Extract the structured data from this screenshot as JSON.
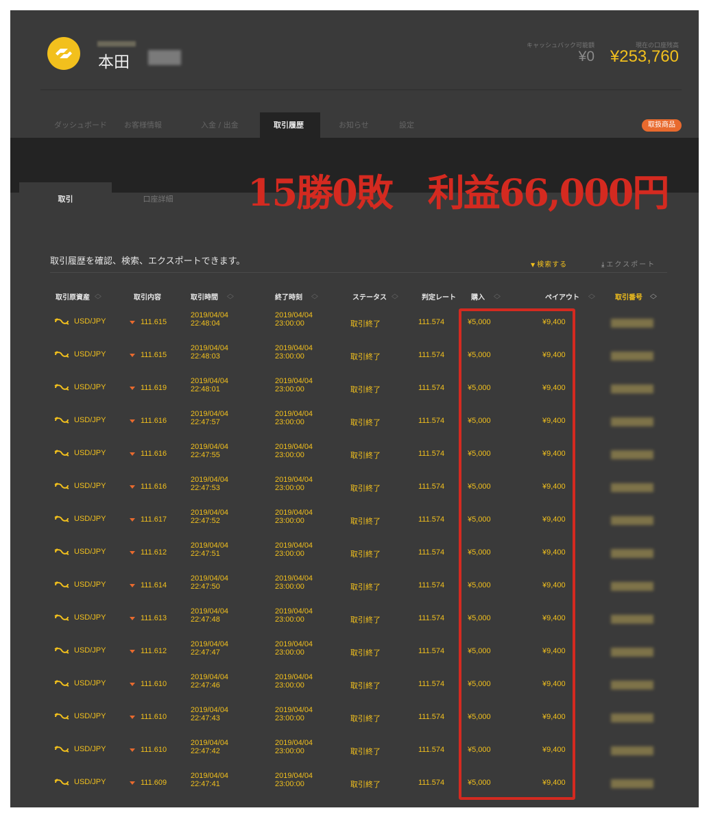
{
  "header": {
    "user_name": "本田",
    "cashback_label": "キャッシュバック可能額",
    "cashback_value": "¥0",
    "balance_label": "現在の口座残高",
    "balance_value": "¥253,760",
    "logo_icon": "swap-logo-icon"
  },
  "nav": {
    "items": [
      "ダッシュボード",
      "お客様情報",
      "入金 / 出金",
      "取引履歴",
      "お知らせ",
      "設定"
    ],
    "active": "取引履歴",
    "products_button": "取扱商品"
  },
  "subtabs": [
    "取引",
    "口座詳細"
  ],
  "overlay_text": "15勝0敗　利益66,000円",
  "toolbar": {
    "intro": "取引履歴を確認、検索、エクスポートできます。",
    "search": "検索する",
    "export": "エクスポート"
  },
  "table": {
    "headers": [
      "取引原資産",
      "取引内容",
      "取引時間",
      "終了時刻",
      "ステータス",
      "判定レート",
      "購入",
      "ペイアウト",
      "取引番号"
    ],
    "rows": [
      {
        "asset": "USD/JPY",
        "content": "111.615",
        "date": "2019/04/04",
        "time": "22:48:04",
        "end_date": "2019/04/04",
        "end_time": "23:00:00",
        "status": "取引終了",
        "rate": "111.574",
        "buy": "¥5,000",
        "payout": "¥9,400"
      },
      {
        "asset": "USD/JPY",
        "content": "111.615",
        "date": "2019/04/04",
        "time": "22:48:03",
        "end_date": "2019/04/04",
        "end_time": "23:00:00",
        "status": "取引終了",
        "rate": "111.574",
        "buy": "¥5,000",
        "payout": "¥9,400"
      },
      {
        "asset": "USD/JPY",
        "content": "111.619",
        "date": "2019/04/04",
        "time": "22:48:01",
        "end_date": "2019/04/04",
        "end_time": "23:00:00",
        "status": "取引終了",
        "rate": "111.574",
        "buy": "¥5,000",
        "payout": "¥9,400"
      },
      {
        "asset": "USD/JPY",
        "content": "111.616",
        "date": "2019/04/04",
        "time": "22:47:57",
        "end_date": "2019/04/04",
        "end_time": "23:00:00",
        "status": "取引終了",
        "rate": "111.574",
        "buy": "¥5,000",
        "payout": "¥9,400"
      },
      {
        "asset": "USD/JPY",
        "content": "111.616",
        "date": "2019/04/04",
        "time": "22:47:55",
        "end_date": "2019/04/04",
        "end_time": "23:00:00",
        "status": "取引終了",
        "rate": "111.574",
        "buy": "¥5,000",
        "payout": "¥9,400"
      },
      {
        "asset": "USD/JPY",
        "content": "111.616",
        "date": "2019/04/04",
        "time": "22:47:53",
        "end_date": "2019/04/04",
        "end_time": "23:00:00",
        "status": "取引終了",
        "rate": "111.574",
        "buy": "¥5,000",
        "payout": "¥9,400"
      },
      {
        "asset": "USD/JPY",
        "content": "111.617",
        "date": "2019/04/04",
        "time": "22:47:52",
        "end_date": "2019/04/04",
        "end_time": "23:00:00",
        "status": "取引終了",
        "rate": "111.574",
        "buy": "¥5,000",
        "payout": "¥9,400"
      },
      {
        "asset": "USD/JPY",
        "content": "111.612",
        "date": "2019/04/04",
        "time": "22:47:51",
        "end_date": "2019/04/04",
        "end_time": "23:00:00",
        "status": "取引終了",
        "rate": "111.574",
        "buy": "¥5,000",
        "payout": "¥9,400"
      },
      {
        "asset": "USD/JPY",
        "content": "111.614",
        "date": "2019/04/04",
        "time": "22:47:50",
        "end_date": "2019/04/04",
        "end_time": "23:00:00",
        "status": "取引終了",
        "rate": "111.574",
        "buy": "¥5,000",
        "payout": "¥9,400"
      },
      {
        "asset": "USD/JPY",
        "content": "111.613",
        "date": "2019/04/04",
        "time": "22:47:48",
        "end_date": "2019/04/04",
        "end_time": "23:00:00",
        "status": "取引終了",
        "rate": "111.574",
        "buy": "¥5,000",
        "payout": "¥9,400"
      },
      {
        "asset": "USD/JPY",
        "content": "111.612",
        "date": "2019/04/04",
        "time": "22:47:47",
        "end_date": "2019/04/04",
        "end_time": "23:00:00",
        "status": "取引終了",
        "rate": "111.574",
        "buy": "¥5,000",
        "payout": "¥9,400"
      },
      {
        "asset": "USD/JPY",
        "content": "111.610",
        "date": "2019/04/04",
        "time": "22:47:46",
        "end_date": "2019/04/04",
        "end_time": "23:00:00",
        "status": "取引終了",
        "rate": "111.574",
        "buy": "¥5,000",
        "payout": "¥9,400"
      },
      {
        "asset": "USD/JPY",
        "content": "111.610",
        "date": "2019/04/04",
        "time": "22:47:43",
        "end_date": "2019/04/04",
        "end_time": "23:00:00",
        "status": "取引終了",
        "rate": "111.574",
        "buy": "¥5,000",
        "payout": "¥9,400"
      },
      {
        "asset": "USD/JPY",
        "content": "111.610",
        "date": "2019/04/04",
        "time": "22:47:42",
        "end_date": "2019/04/04",
        "end_time": "23:00:00",
        "status": "取引終了",
        "rate": "111.574",
        "buy": "¥5,000",
        "payout": "¥9,400"
      },
      {
        "asset": "USD/JPY",
        "content": "111.609",
        "date": "2019/04/04",
        "time": "22:47:41",
        "end_date": "2019/04/04",
        "end_time": "23:00:00",
        "status": "取引終了",
        "rate": "111.574",
        "buy": "¥5,000",
        "payout": "¥9,400"
      }
    ]
  },
  "colors": {
    "accent": "#f2c01d",
    "highlight_box": "#d42a20",
    "put_arrow": "#e86a2e"
  }
}
